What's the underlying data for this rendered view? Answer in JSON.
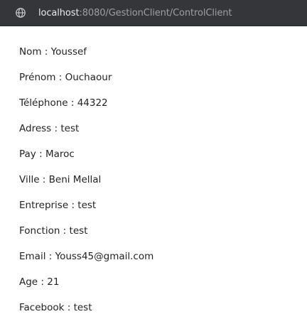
{
  "browser": {
    "url_host": "localhost",
    "url_rest": ":8080/GestionClient/ControlClient",
    "site_info_icon": "globe-icon"
  },
  "client": {
    "fields": [
      {
        "label": "Nom",
        "value": "Youssef"
      },
      {
        "label": "Prénom",
        "value": "Ouchaour"
      },
      {
        "label": "Téléphone",
        "value": "44322"
      },
      {
        "label": "Adress",
        "value": "test"
      },
      {
        "label": "Pay",
        "value": "Maroc"
      },
      {
        "label": "Ville",
        "value": "Beni Mellal"
      },
      {
        "label": "Entreprise",
        "value": "test"
      },
      {
        "label": "Fonction",
        "value": "test"
      },
      {
        "label": "Email",
        "value": "Youss45@gmail.com"
      },
      {
        "label": "Age",
        "value": "21"
      },
      {
        "label": "Facebook",
        "value": "test"
      }
    ]
  }
}
